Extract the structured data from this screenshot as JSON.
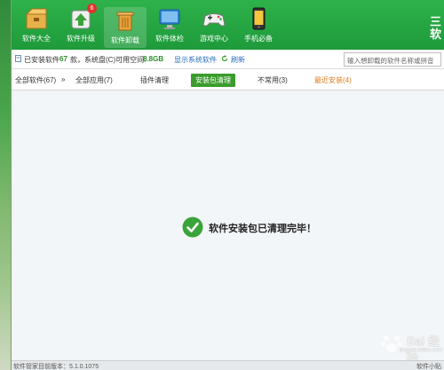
{
  "toolbar": {
    "items": [
      {
        "label": "软件大全",
        "icon": "box-icon"
      },
      {
        "label": "软件升级",
        "icon": "upgrade-icon",
        "badge": "6"
      },
      {
        "label": "软件卸载",
        "icon": "trash-icon"
      },
      {
        "label": "软件体检",
        "icon": "monitor-icon"
      },
      {
        "label": "游戏中心",
        "icon": "gamepad-icon"
      },
      {
        "label": "手机必备",
        "icon": "phone-icon"
      }
    ],
    "brand": "三\n软"
  },
  "info": {
    "installed_label": "已安装软件",
    "installed_count": "67",
    "disk_text": "款，系统盘(C)可用空间:",
    "disk_free": "8.8GB",
    "show_system": "显示系统软件",
    "refresh": "刷新",
    "search_placeholder": "输入想卸载的软件名称或拼音"
  },
  "tabs": {
    "all_software": "全部软件(67)",
    "all_apps": "全部应用(7)",
    "plugin_clean": "插件清理",
    "installer_clean": "安装包清理",
    "rarely_used": "不常用(3)",
    "recently_installed": "最近安装(4)"
  },
  "message": {
    "text": "软件安装包已清理完毕！"
  },
  "status": {
    "version": "软件管家目前版本：5.1.0.1075",
    "right": "软件小贴"
  },
  "watermark": {
    "text": "Bai 经验",
    "sub": "jingyan.baidu.com"
  },
  "colors": {
    "toolbar": "#1e9a3b",
    "accent_green": "#3a9c2c",
    "orange": "#e07b18",
    "link_blue": "#2a6fbf"
  }
}
